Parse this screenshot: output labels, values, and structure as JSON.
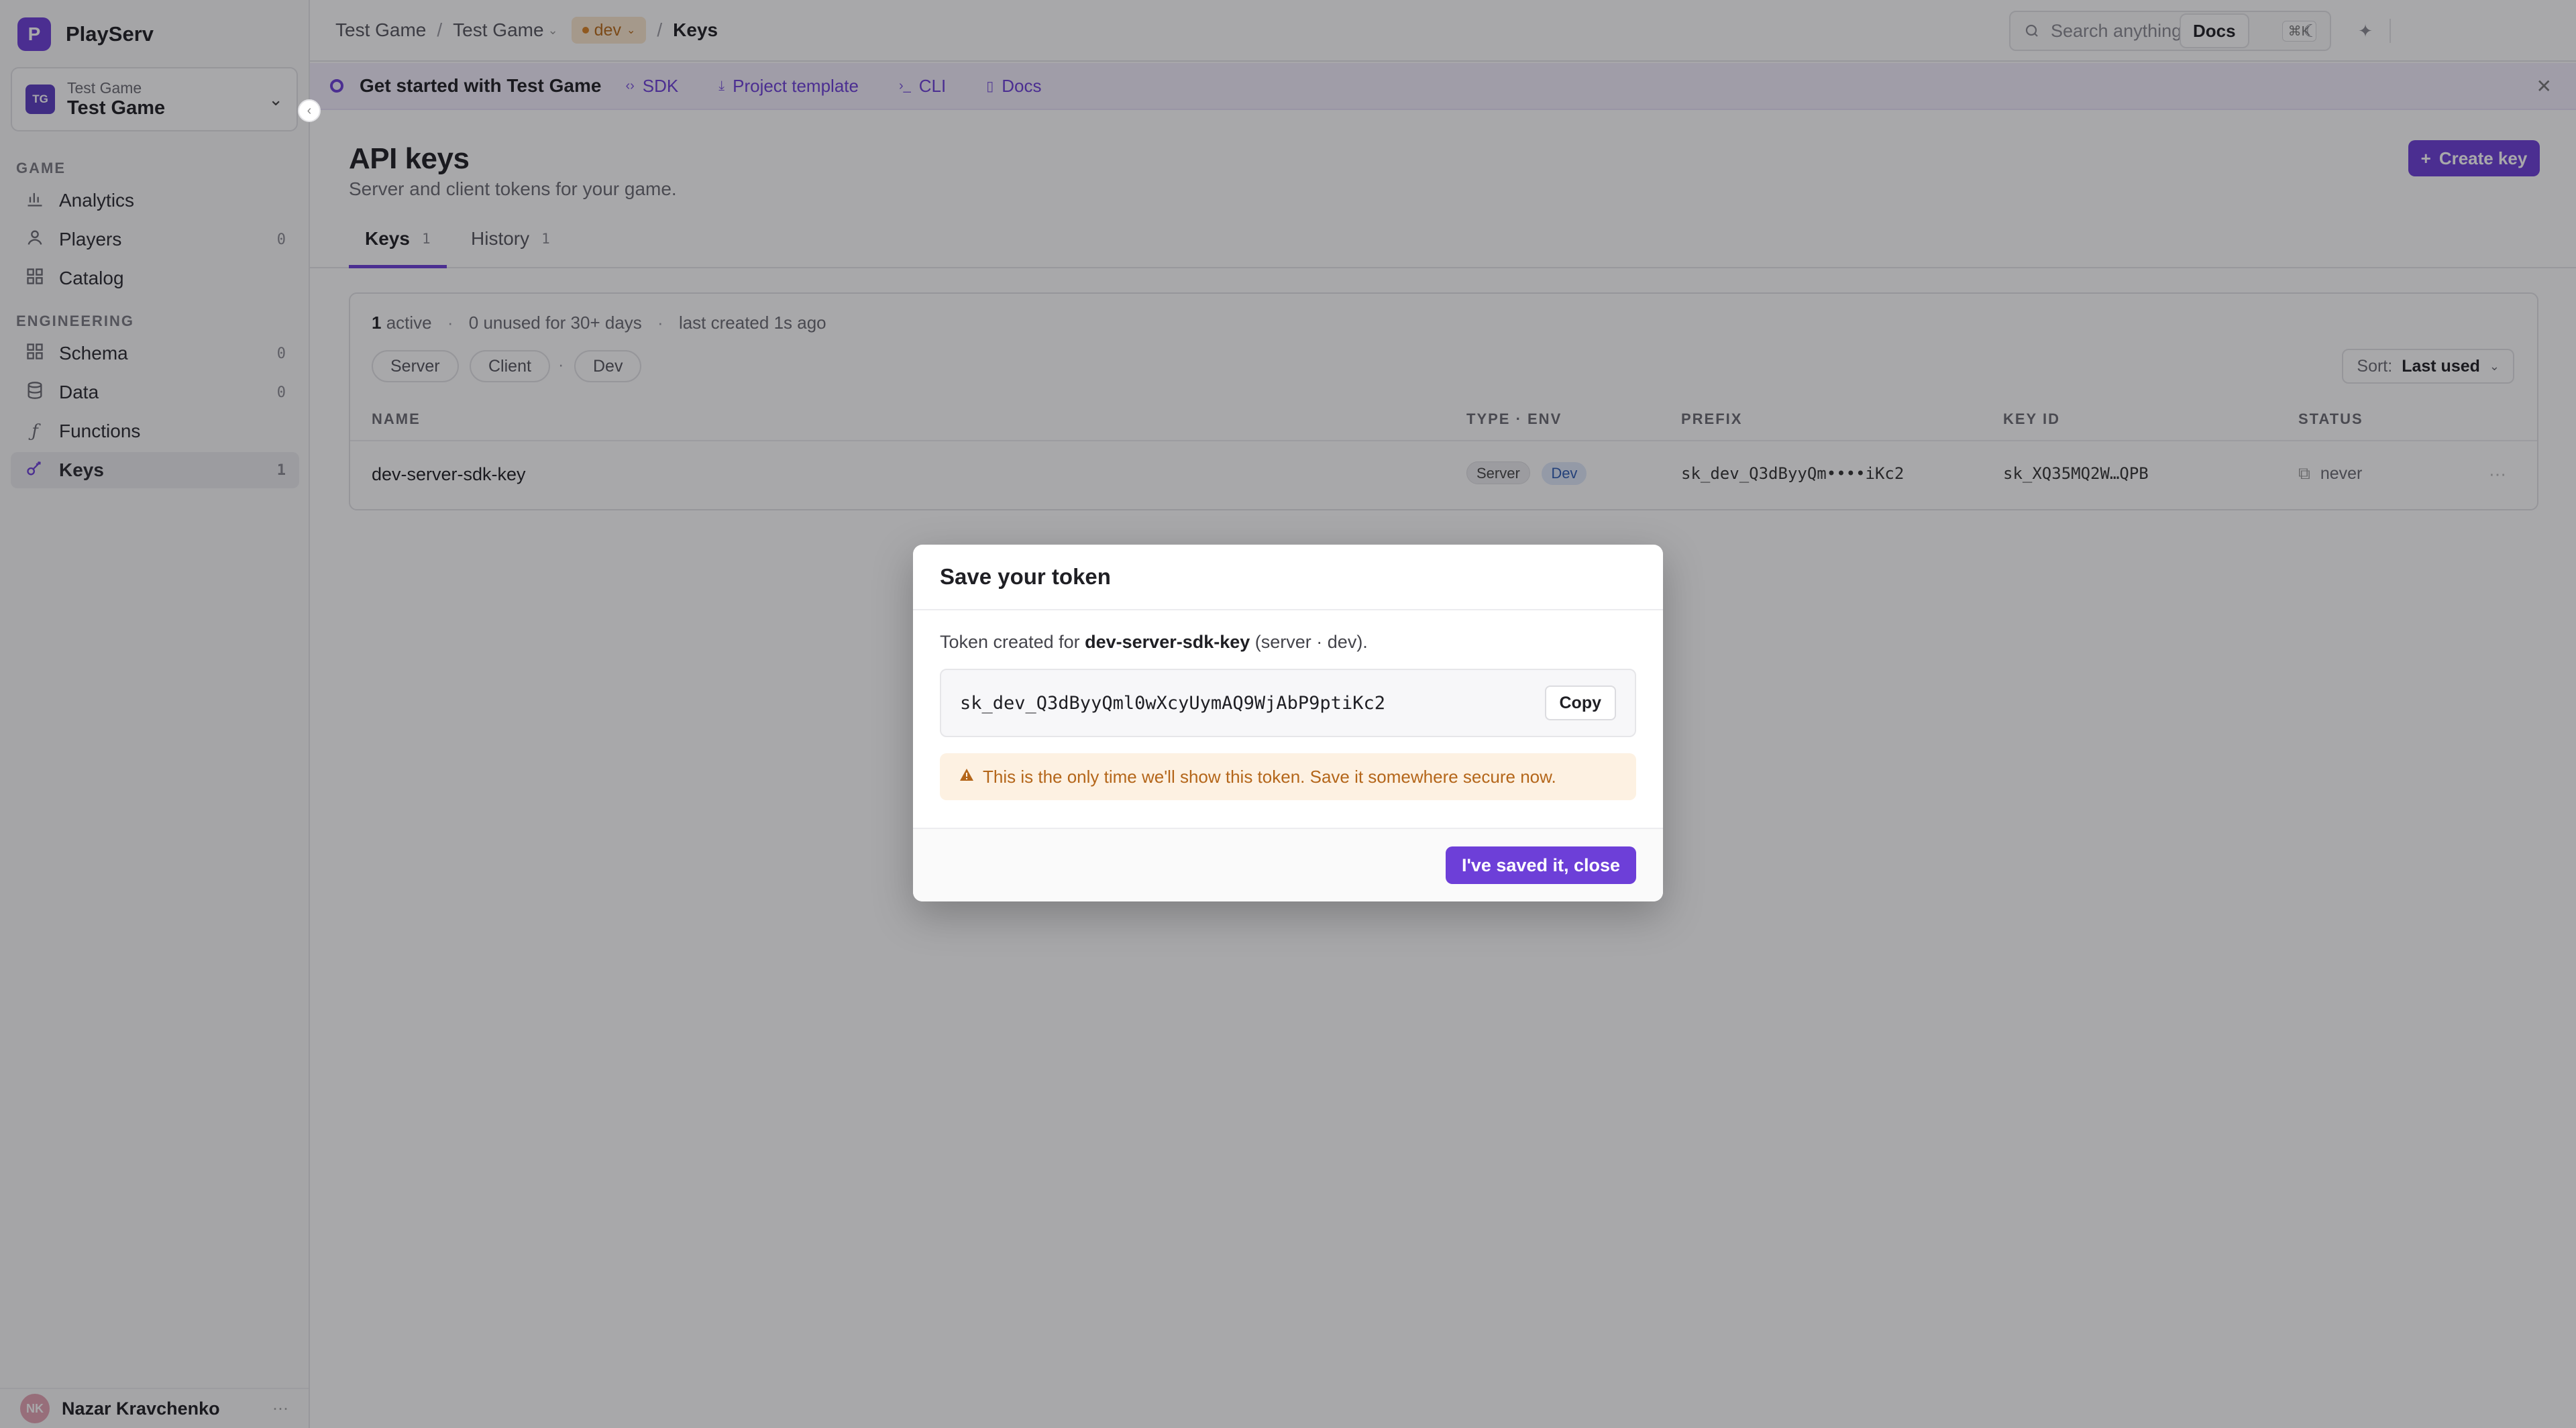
{
  "brand": {
    "logo_letter": "P",
    "name": "PlayServ"
  },
  "project": {
    "avatar": "TG",
    "sub": "Test Game",
    "name": "Test Game"
  },
  "sidebar": {
    "sections": [
      {
        "label": "GAME"
      },
      {
        "label": "ENGINEERING"
      }
    ],
    "items": [
      {
        "label": "Analytics",
        "icon": "bar-chart-icon",
        "count": ""
      },
      {
        "label": "Players",
        "icon": "user-icon",
        "count": "0"
      },
      {
        "label": "Catalog",
        "icon": "grid-icon",
        "count": ""
      },
      {
        "label": "Schema",
        "icon": "grid-icon",
        "count": "0"
      },
      {
        "label": "Data",
        "icon": "database-icon",
        "count": "0"
      },
      {
        "label": "Functions",
        "icon": "function-icon",
        "count": ""
      },
      {
        "label": "Keys",
        "icon": "key-icon",
        "count": "1"
      }
    ],
    "user": {
      "initials": "NK",
      "name": "Nazar Kravchenko"
    }
  },
  "topbar": {
    "breadcrumb": [
      "Test Game",
      "Test Game",
      "Keys"
    ],
    "env": "dev",
    "search_placeholder": "Search anything",
    "search_shortcut": "⌘K",
    "docs_label": "Docs"
  },
  "banner": {
    "title": "Get started with Test Game",
    "links": [
      {
        "label": "SDK",
        "icon": "code-icon"
      },
      {
        "label": "Project template",
        "icon": "download-icon"
      },
      {
        "label": "CLI",
        "icon": "terminal-icon"
      },
      {
        "label": "Docs",
        "icon": "doc-icon"
      }
    ]
  },
  "page": {
    "title": "API keys",
    "subtitle": "Server and client tokens for your game.",
    "create_label": "Create key"
  },
  "tabs": [
    {
      "label": "Keys",
      "count": "1"
    },
    {
      "label": "History",
      "count": "1"
    }
  ],
  "summary": {
    "active_count": "1",
    "active_label": "active",
    "unused": "0 unused for 30+ days",
    "last_created": "last created 1s ago"
  },
  "filters": [
    "Server",
    "Client",
    "Dev"
  ],
  "filter_sep": "·",
  "sort": {
    "label": "Sort:",
    "value": "Last used"
  },
  "table": {
    "headers": [
      "NAME",
      "TYPE · ENV",
      "PREFIX",
      "KEY ID",
      "STATUS"
    ],
    "rows": [
      {
        "name": "dev-server-sdk-key",
        "type": "Server",
        "env": "Dev",
        "prefix": "sk_dev_Q3dByyQm••••iKc2",
        "key_id": "sk_XQ35MQ2W…QPB",
        "status": "never"
      }
    ]
  },
  "modal": {
    "title": "Save your token",
    "desc_prefix": "Token created for ",
    "key_name": "dev-server-sdk-key",
    "desc_suffix": " (server · dev).",
    "token": "sk_dev_Q3dByyQml0wXcyUymAQ9WjAbP9ptiKc2",
    "copy_label": "Copy",
    "warning": "This is the only time we'll show this token. Save it somewhere secure now.",
    "confirm_label": "I've saved it, close"
  },
  "colors": {
    "accent": "#6d3fd8",
    "env_badge": "#fbe7cf",
    "warning_bg": "#fdf1e2",
    "warning_text": "#b4661a"
  }
}
